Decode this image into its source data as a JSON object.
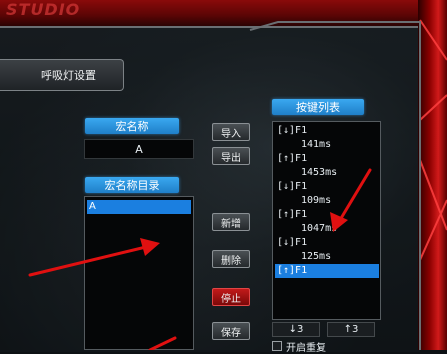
{
  "app": {
    "top_title": "STUDIO"
  },
  "sidebar": {
    "breath_light_label": "呼吸灯设置"
  },
  "macro": {
    "name_label": "宏名称",
    "name_value": "A",
    "catalog_label": "宏名称目录",
    "items": [
      "A"
    ]
  },
  "buttons": {
    "import": "导入",
    "export": "导出",
    "new": "新增",
    "delete": "删除",
    "stop": "停止",
    "save": "保存"
  },
  "keys": {
    "label": "按键列表",
    "rows": [
      {
        "text": "[↓]F1",
        "indent": false,
        "selected": false
      },
      {
        "text": "141ms",
        "indent": true,
        "selected": false
      },
      {
        "text": "[↑]F1",
        "indent": false,
        "selected": false
      },
      {
        "text": "1453ms",
        "indent": true,
        "selected": false
      },
      {
        "text": "[↓]F1",
        "indent": false,
        "selected": false
      },
      {
        "text": "109ms",
        "indent": true,
        "selected": false
      },
      {
        "text": "[↑]F1",
        "indent": false,
        "selected": false
      },
      {
        "text": "1047ms",
        "indent": true,
        "selected": false
      },
      {
        "text": "[↓]F1",
        "indent": false,
        "selected": false
      },
      {
        "text": "125ms",
        "indent": true,
        "selected": false
      },
      {
        "text": "[↑]F1",
        "indent": false,
        "selected": true
      }
    ],
    "down_count": "↓3",
    "up_count": "↑3",
    "repeat_label": "开启重复"
  },
  "colors": {
    "accent_blue": "#1b7fe0",
    "stop_red": "#c21a1a",
    "annotation_red": "#e01010"
  }
}
